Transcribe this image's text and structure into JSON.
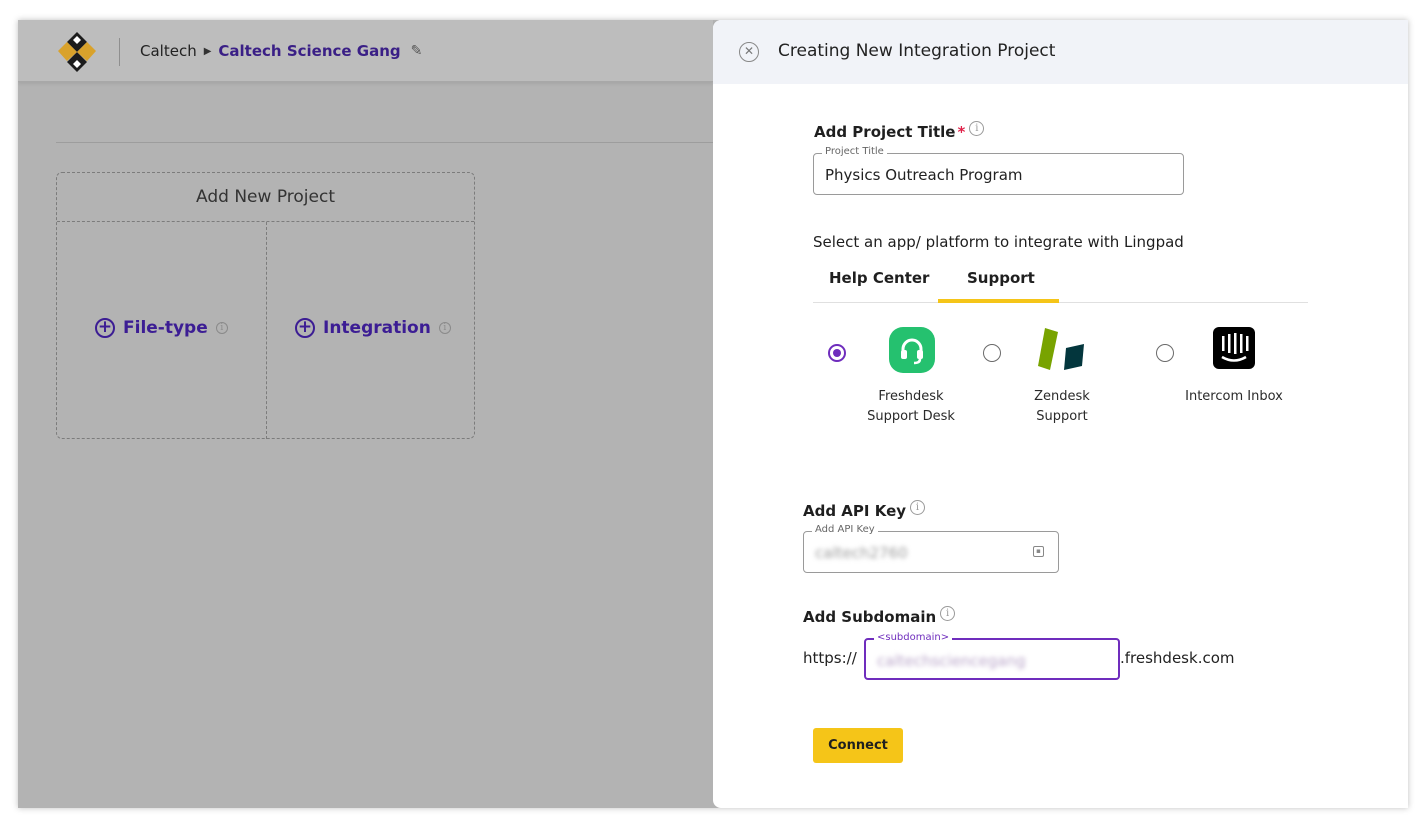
{
  "app": {
    "breadcrumb": {
      "org": "Caltech",
      "team": "Caltech Science Gang"
    }
  },
  "project_card": {
    "title": "Add New Project",
    "options": [
      {
        "label": "File-type"
      },
      {
        "label": "Integration"
      }
    ]
  },
  "panel": {
    "title": "Creating New Integration Project",
    "project_title": {
      "label": "Add Project Title",
      "required_mark": "*",
      "legend": "Project Title",
      "value": "Physics Outreach Program"
    },
    "app_select_label": "Select an app/ platform to integrate with Lingpad",
    "tabs": [
      {
        "label": "Help Center",
        "active": false
      },
      {
        "label": "Support",
        "active": true
      }
    ],
    "apps": [
      {
        "name_line1": "Freshdesk",
        "name_line2": "Support Desk",
        "icon": "freshdesk-icon",
        "selected": true,
        "color": "#25c16f"
      },
      {
        "name_line1": "Zendesk",
        "name_line2": "Support",
        "icon": "zendesk-icon",
        "selected": false,
        "color": "#78a300"
      },
      {
        "name_line1": "Intercom Inbox",
        "name_line2": "",
        "icon": "intercom-icon",
        "selected": false,
        "color": "#000000"
      }
    ],
    "api_key": {
      "label": "Add API Key",
      "legend": "Add API Key",
      "value": "caltech2760"
    },
    "subdomain": {
      "label": "Add Subdomain",
      "prefix": "https://",
      "legend": "<subdomain>",
      "value": "caltechsciencegang",
      "suffix": ".freshdesk.com"
    },
    "connect_label": "Connect"
  },
  "colors": {
    "accent_purple": "#6f2dbd",
    "accent_yellow": "#f5c518",
    "required_red": "#e0234a"
  }
}
